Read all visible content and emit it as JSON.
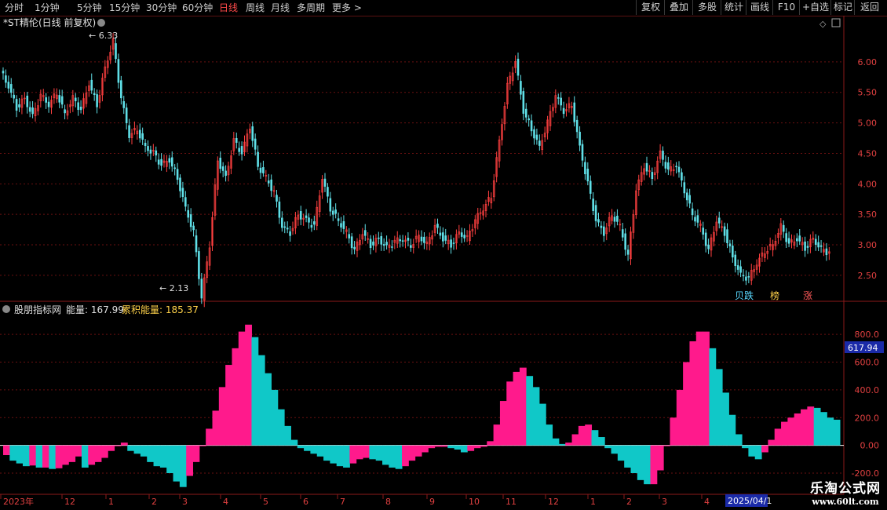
{
  "toolbar": {
    "periods": [
      "分时",
      "1分钟",
      "5分钟",
      "15分钟",
      "30分钟",
      "60分钟",
      "日线",
      "周线",
      "月线",
      "多周期",
      "更多 >"
    ],
    "active_period": "日线",
    "right_buttons": [
      "复权",
      "叠加",
      "多股",
      "统计",
      "画线",
      "F10",
      "+自选",
      "返回"
    ]
  },
  "stock": {
    "title": "*ST精伦(日线 前复权)",
    "high_label": "6.33",
    "low_label": "2.13",
    "markers": [
      {
        "text": "贝跌",
        "color": "#58d8ff"
      },
      {
        "text": "榜",
        "color": "#ffd24a"
      },
      {
        "text": "涨",
        "color": "#ff5a5a"
      }
    ]
  },
  "indicator": {
    "name": "股朋指标网",
    "energy_label": "能量: 167.99",
    "cum_label": "累积能量: 185.37",
    "current_value_box": "617.94"
  },
  "footer": {
    "logo_text": "乐淘公式网",
    "logo_url": "www.60lt.com",
    "date_box": "2025/04/1"
  },
  "chart_data": [
    {
      "type": "candlestick",
      "title": "*ST精伦(日线 前复权)",
      "y_ticks": [
        "2.50",
        "3.00",
        "3.50",
        "4.00",
        "4.50",
        "5.00",
        "5.50",
        "6.00"
      ],
      "ylim": [
        2.1,
        6.5
      ],
      "high": 6.33,
      "low": 2.13,
      "close_path": [
        5.85,
        5.6,
        5.25,
        5.4,
        5.1,
        5.45,
        5.3,
        5.5,
        5.15,
        5.4,
        5.2,
        5.65,
        5.3,
        5.9,
        6.33,
        5.4,
        4.8,
        4.9,
        4.6,
        4.5,
        4.3,
        4.4,
        4.1,
        3.6,
        3.2,
        2.13,
        3.0,
        4.4,
        4.1,
        4.7,
        4.5,
        4.95,
        4.3,
        4.1,
        3.85,
        3.3,
        3.2,
        3.5,
        3.4,
        3.3,
        4.1,
        3.6,
        3.4,
        3.2,
        2.9,
        3.2,
        3.0,
        3.1,
        2.95,
        3.05,
        3.1,
        3.0,
        3.15,
        3.0,
        3.3,
        3.1,
        3.0,
        3.2,
        3.1,
        3.4,
        3.6,
        3.8,
        4.7,
        5.6,
        6.0,
        5.2,
        4.9,
        4.6,
        5.0,
        5.45,
        5.2,
        5.3,
        4.6,
        4.0,
        3.4,
        3.2,
        3.5,
        3.3,
        2.8,
        3.9,
        4.3,
        4.1,
        4.5,
        4.2,
        4.3,
        3.9,
        3.5,
        3.3,
        2.9,
        3.4,
        3.2,
        2.8,
        2.5,
        2.45,
        2.7,
        2.9,
        3.0,
        3.3,
        3.0,
        3.1,
        2.95,
        3.1,
        2.92,
        2.87
      ]
    },
    {
      "type": "bar",
      "title": "股朋指标网",
      "y_ticks": [
        "-200.0",
        "0.00",
        "200.0",
        "400.0",
        "600.0",
        "800.0"
      ],
      "ylim": [
        -330,
        880
      ],
      "series": [
        {
          "name": "能量",
          "values": [
            -70,
            -110,
            -130,
            -150,
            -145,
            -160,
            -160,
            -170,
            -165,
            -140,
            -120,
            -80,
            -160,
            -140,
            -120,
            -90,
            -40,
            0,
            20,
            -40,
            -60,
            -80,
            -120,
            -150,
            -160,
            -200,
            -260,
            -300,
            -220,
            -120,
            0,
            120,
            250,
            420,
            580,
            700,
            820,
            870,
            780,
            650,
            520,
            400,
            260,
            140,
            40,
            -20,
            -40,
            -60,
            -80,
            -110,
            -130,
            -150,
            -160,
            -130,
            -100,
            -90,
            -100,
            -110,
            -140,
            -160,
            -170,
            -150,
            -110,
            -80,
            -50,
            -20,
            -10,
            -10,
            -20,
            -30,
            -50,
            -40,
            -20,
            -10,
            30,
            150,
            320,
            460,
            530,
            560,
            500,
            420,
            300,
            150,
            50,
            10,
            20,
            80,
            140,
            150,
            110,
            60,
            -20,
            -60,
            -110,
            -160,
            -200,
            -250,
            -280,
            -280,
            -180,
            0,
            200,
            400,
            600,
            750,
            820,
            820,
            700,
            550,
            380,
            220,
            80,
            -20,
            -80,
            -100,
            -50,
            40,
            120,
            170,
            200,
            230,
            260,
            280,
            270,
            240,
            200,
            185
          ],
          "colors": "pink=positive accumulation, cyan=negative"
        }
      ]
    }
  ],
  "x_labels": [
    "2023年",
    "12",
    "1",
    "2",
    "3",
    "4",
    "5",
    "6",
    "7",
    "8",
    "9",
    "10",
    "11",
    "12",
    "1",
    "2",
    "3",
    "4"
  ]
}
